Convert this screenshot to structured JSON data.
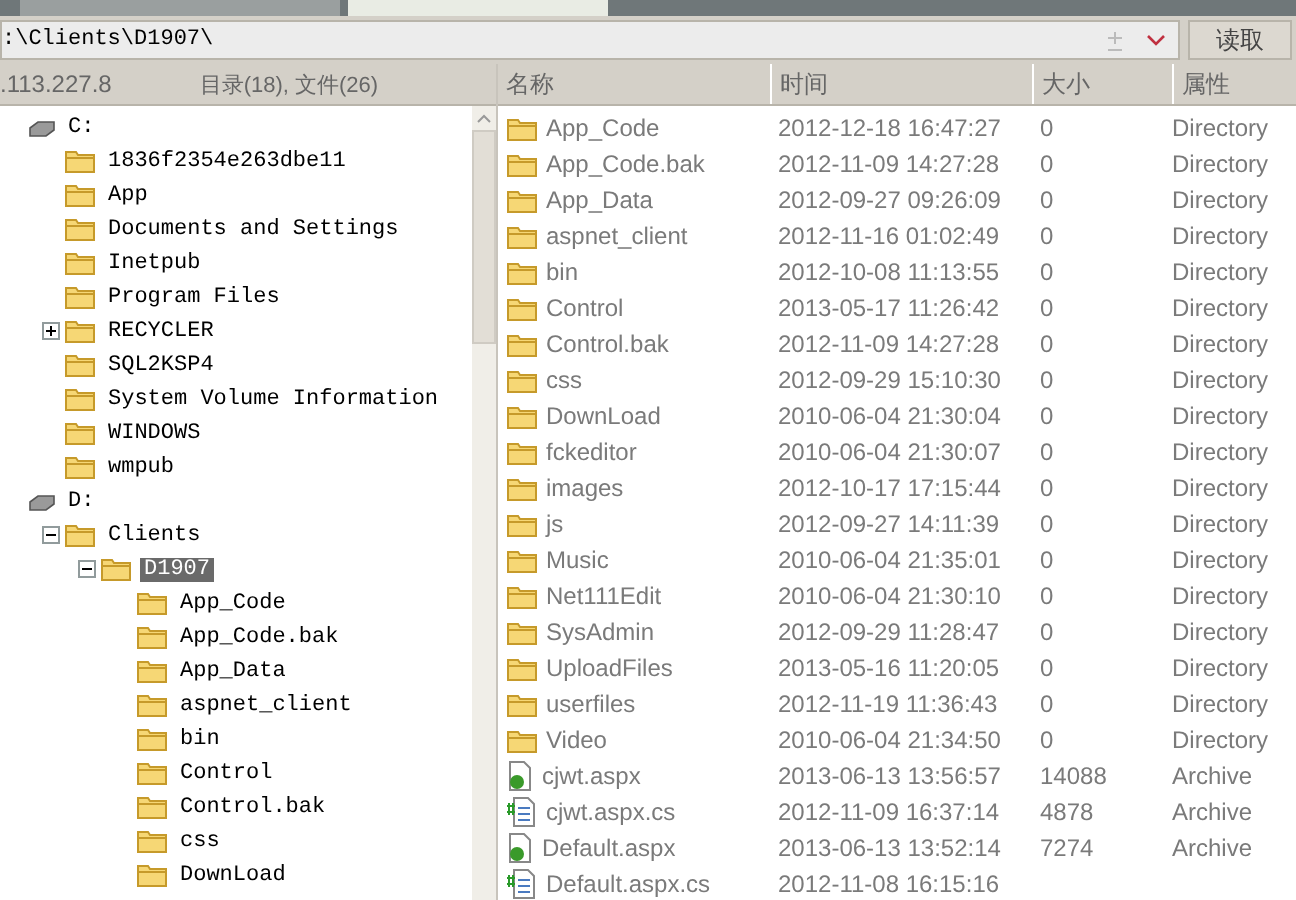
{
  "address_bar": {
    "path": ":\\Clients\\D1907\\",
    "read_button": "读取"
  },
  "left_header": {
    "host": ".113.227.8",
    "summary": "目录(18), 文件(26)"
  },
  "tree": [
    {
      "label": "C:",
      "kind": "drive",
      "selected": false,
      "children": [
        {
          "label": "1836f2354e263dbe11",
          "kind": "folder",
          "selected": false
        },
        {
          "label": "App",
          "kind": "folder",
          "selected": false
        },
        {
          "label": "Documents and Settings",
          "kind": "folder",
          "selected": false
        },
        {
          "label": "Inetpub",
          "kind": "folder",
          "selected": false
        },
        {
          "label": "Program Files",
          "kind": "folder",
          "selected": false
        },
        {
          "label": "RECYCLER",
          "kind": "folder",
          "expanded": false,
          "selected": false
        },
        {
          "label": "SQL2KSP4",
          "kind": "folder",
          "selected": false
        },
        {
          "label": "System Volume Information",
          "kind": "folder",
          "selected": false
        },
        {
          "label": "WINDOWS",
          "kind": "folder",
          "selected": false
        },
        {
          "label": "wmpub",
          "kind": "folder",
          "selected": false
        }
      ]
    },
    {
      "label": "D:",
      "kind": "drive",
      "selected": false,
      "children": [
        {
          "label": "Clients",
          "kind": "folder",
          "expanded": true,
          "selected": false,
          "children": [
            {
              "label": "D1907",
              "kind": "folder",
              "expanded": true,
              "selected": true,
              "children": [
                {
                  "label": "App_Code",
                  "kind": "folder",
                  "selected": false
                },
                {
                  "label": "App_Code.bak",
                  "kind": "folder",
                  "selected": false
                },
                {
                  "label": "App_Data",
                  "kind": "folder",
                  "selected": false
                },
                {
                  "label": "aspnet_client",
                  "kind": "folder",
                  "selected": false
                },
                {
                  "label": "bin",
                  "kind": "folder",
                  "selected": false
                },
                {
                  "label": "Control",
                  "kind": "folder",
                  "selected": false
                },
                {
                  "label": "Control.bak",
                  "kind": "folder",
                  "selected": false
                },
                {
                  "label": "css",
                  "kind": "folder",
                  "selected": false
                },
                {
                  "label": "DownLoad",
                  "kind": "folder",
                  "selected": false
                }
              ]
            }
          ]
        }
      ]
    }
  ],
  "file_list": {
    "columns": [
      "名称",
      "时间",
      "大小",
      "属性"
    ],
    "rows": [
      {
        "kind": "folder",
        "name": "App_Code",
        "time": "2012-12-18 16:47:27",
        "size": "0",
        "attribute": "Directory"
      },
      {
        "kind": "folder",
        "name": "App_Code.bak",
        "time": "2012-11-09 14:27:28",
        "size": "0",
        "attribute": "Directory"
      },
      {
        "kind": "folder",
        "name": "App_Data",
        "time": "2012-09-27 09:26:09",
        "size": "0",
        "attribute": "Directory"
      },
      {
        "kind": "folder",
        "name": "aspnet_client",
        "time": "2012-11-16 01:02:49",
        "size": "0",
        "attribute": "Directory"
      },
      {
        "kind": "folder",
        "name": "bin",
        "time": "2012-10-08 11:13:55",
        "size": "0",
        "attribute": "Directory"
      },
      {
        "kind": "folder",
        "name": "Control",
        "time": "2013-05-17 11:26:42",
        "size": "0",
        "attribute": "Directory"
      },
      {
        "kind": "folder",
        "name": "Control.bak",
        "time": "2012-11-09 14:27:28",
        "size": "0",
        "attribute": "Directory"
      },
      {
        "kind": "folder",
        "name": "css",
        "time": "2012-09-29 15:10:30",
        "size": "0",
        "attribute": "Directory"
      },
      {
        "kind": "folder",
        "name": "DownLoad",
        "time": "2010-06-04 21:30:04",
        "size": "0",
        "attribute": "Directory"
      },
      {
        "kind": "folder",
        "name": "fckeditor",
        "time": "2010-06-04 21:30:07",
        "size": "0",
        "attribute": "Directory"
      },
      {
        "kind": "folder",
        "name": "images",
        "time": "2012-10-17 17:15:44",
        "size": "0",
        "attribute": "Directory"
      },
      {
        "kind": "folder",
        "name": "js",
        "time": "2012-09-27 14:11:39",
        "size": "0",
        "attribute": "Directory"
      },
      {
        "kind": "folder",
        "name": "Music",
        "time": "2010-06-04 21:35:01",
        "size": "0",
        "attribute": "Directory"
      },
      {
        "kind": "folder",
        "name": "Net111Edit",
        "time": "2010-06-04 21:30:10",
        "size": "0",
        "attribute": "Directory"
      },
      {
        "kind": "folder",
        "name": "SysAdmin",
        "time": "2012-09-29 11:28:47",
        "size": "0",
        "attribute": "Directory"
      },
      {
        "kind": "folder",
        "name": "UploadFiles",
        "time": "2013-05-16 11:20:05",
        "size": "0",
        "attribute": "Directory"
      },
      {
        "kind": "folder",
        "name": "userfiles",
        "time": "2012-11-19 11:36:43",
        "size": "0",
        "attribute": "Directory"
      },
      {
        "kind": "folder",
        "name": "Video",
        "time": "2010-06-04 21:34:50",
        "size": "0",
        "attribute": "Directory"
      },
      {
        "kind": "aspx",
        "name": "cjwt.aspx",
        "time": "2013-06-13 13:56:57",
        "size": "14088",
        "attribute": "Archive"
      },
      {
        "kind": "cs",
        "name": "cjwt.aspx.cs",
        "time": "2012-11-09 16:37:14",
        "size": "4878",
        "attribute": "Archive"
      },
      {
        "kind": "aspx",
        "name": "Default.aspx",
        "time": "2013-06-13 13:52:14",
        "size": "7274",
        "attribute": "Archive"
      },
      {
        "kind": "cs",
        "name": "Default.aspx.cs",
        "time": "2012-11-08 16:15:16"
      }
    ]
  }
}
